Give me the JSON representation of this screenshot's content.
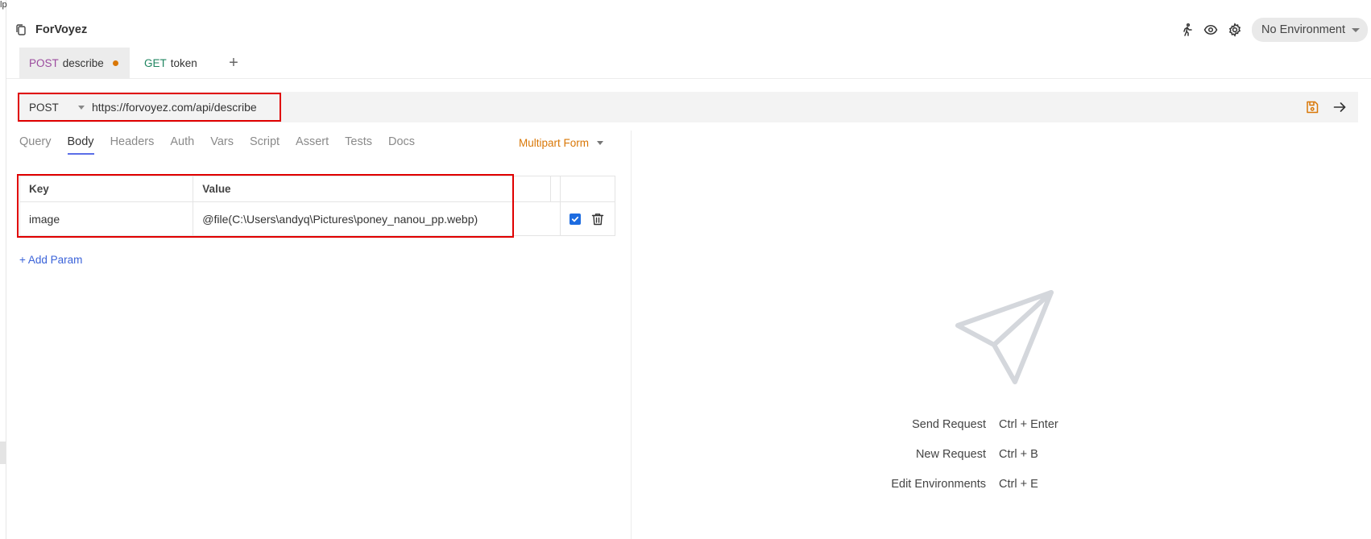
{
  "edge": {
    "letter": "lp"
  },
  "collection": {
    "name": "ForVoyez",
    "icon": "copy-icon"
  },
  "header": {
    "environment_label": "No Environment",
    "icons": [
      "runner-icon",
      "eye-icon",
      "gear-icon"
    ]
  },
  "tabs": [
    {
      "method": "POST",
      "name": "describe",
      "modified": true
    },
    {
      "method": "GET",
      "name": "token",
      "modified": false
    }
  ],
  "add_tab_label": "+",
  "request": {
    "method": "POST",
    "url": "https://forvoyez.com/api/describe"
  },
  "subtabs": [
    "Query",
    "Body",
    "Headers",
    "Auth",
    "Vars",
    "Script",
    "Assert",
    "Tests",
    "Docs"
  ],
  "active_subtab": "Body",
  "body_mode": "Multipart Form",
  "params_table": {
    "headers": [
      "Key",
      "Value"
    ],
    "rows": [
      {
        "key": "image",
        "value": "@file(C:\\Users\\andyq\\Pictures\\poney_nanou_pp.webp)",
        "enabled": true
      }
    ]
  },
  "add_param_label": "+ Add Param",
  "shortcuts": [
    {
      "label": "Send Request",
      "keys": "Ctrl + Enter"
    },
    {
      "label": "New Request",
      "keys": "Ctrl + B"
    },
    {
      "label": "Edit Environments",
      "keys": "Ctrl + E"
    }
  ],
  "colors": {
    "post": "#9b4b9e",
    "get": "#1f8560",
    "accent_orange": "#d97706",
    "highlight_red": "#e00000",
    "link_blue": "#3b63d9"
  }
}
